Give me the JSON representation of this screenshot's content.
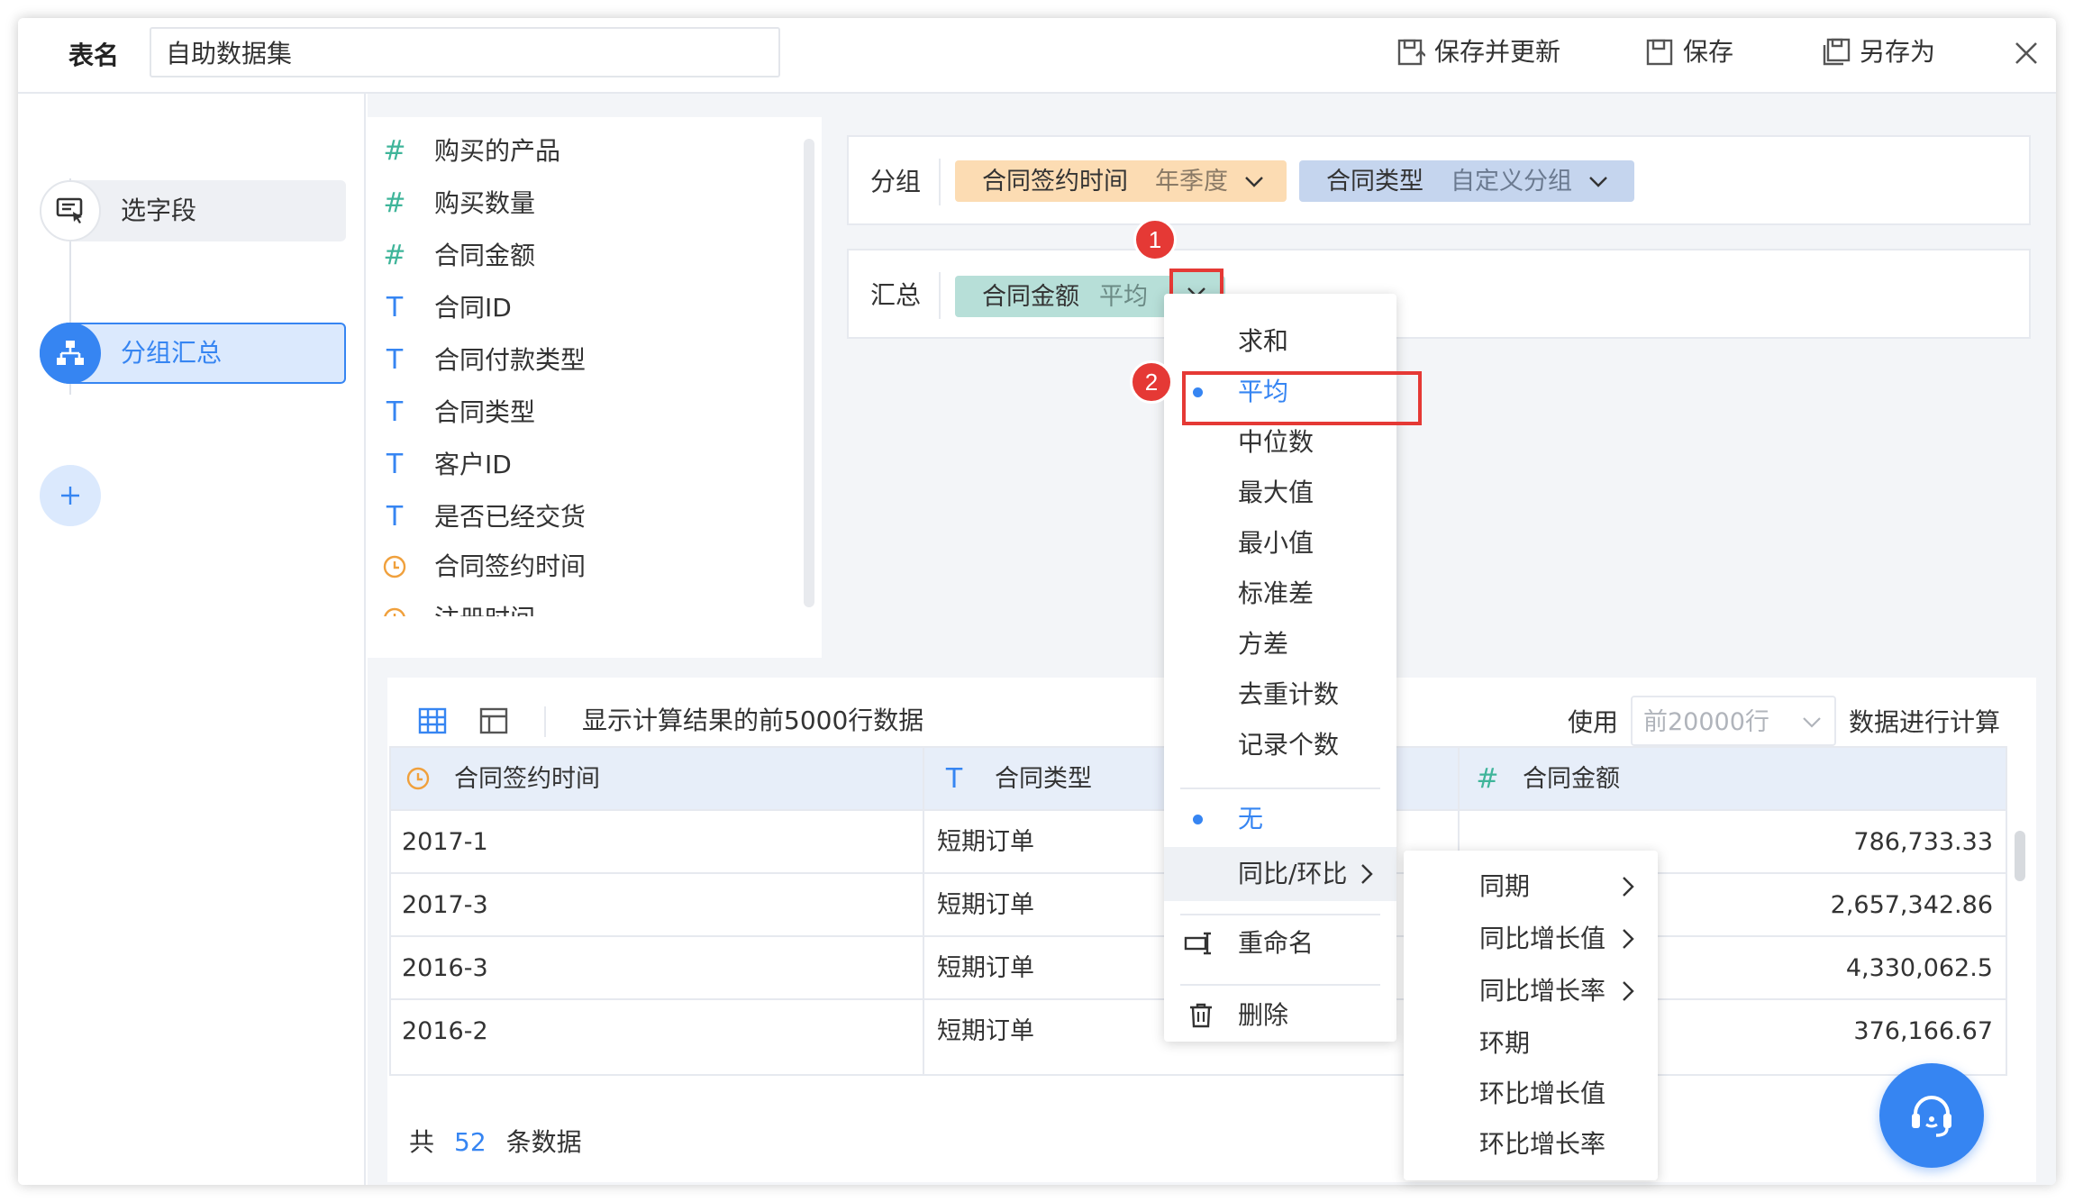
{
  "header": {
    "table_name_label": "表名",
    "table_name_value": "自助数据集",
    "save_update_label": "保存并更新",
    "save_label": "保存",
    "save_as_label": "另存为"
  },
  "steps": [
    {
      "label": "选字段"
    },
    {
      "label": "分组汇总"
    }
  ],
  "fields": [
    {
      "type": "#",
      "label": "购买的产品"
    },
    {
      "type": "#",
      "label": "购买数量"
    },
    {
      "type": "#",
      "label": "合同金额"
    },
    {
      "type": "T",
      "label": "合同ID"
    },
    {
      "type": "T",
      "label": "合同付款类型"
    },
    {
      "type": "T",
      "label": "合同类型"
    },
    {
      "type": "T",
      "label": "客户ID"
    },
    {
      "type": "T",
      "label": "是否已经交货"
    },
    {
      "type": "clock",
      "label": "合同签约时间"
    },
    {
      "type": "clock",
      "label": "注册时间"
    }
  ],
  "group": {
    "label": "分组",
    "chips": [
      {
        "name": "合同签约时间",
        "mode": "年季度"
      },
      {
        "name": "合同类型",
        "mode": "自定义分组"
      }
    ]
  },
  "summary": {
    "label": "汇总",
    "chip": {
      "name": "合同金额",
      "mode": "平均"
    }
  },
  "agg_menu": {
    "items": [
      "求和",
      "平均",
      "中位数",
      "最大值",
      "最小值",
      "标准差",
      "方差",
      "去重计数",
      "记录个数"
    ],
    "selected": "平均",
    "none_label": "无",
    "compare_label": "同比/环比",
    "rename_label": "重命名",
    "delete_label": "删除"
  },
  "compare_submenu": [
    "同期",
    "同比增长值",
    "同比增长率",
    "环期",
    "环比增长值",
    "环比增长率"
  ],
  "badges": [
    "1",
    "2"
  ],
  "preview": {
    "info_text": "显示计算结果的前5000行数据",
    "use_label": "使用",
    "rows_select_placeholder": "前20000行",
    "compute_label": "数据进行计算",
    "columns": [
      "合同签约时间",
      "合同类型",
      "合同金额"
    ],
    "rows": [
      [
        "2017-1",
        "短期订单",
        "786,733.33"
      ],
      [
        "2017-3",
        "短期订单",
        "2,657,342.86"
      ],
      [
        "2016-3",
        "短期订单",
        "4,330,062.5"
      ],
      [
        "2016-2",
        "短期订单",
        "376,166.67"
      ]
    ],
    "total_prefix": "共",
    "total_count": "52",
    "total_suffix": "条数据"
  },
  "colors": {
    "accent": "#3685f2",
    "group_chip_time": "#fcdcb3",
    "group_chip_type": "#c5d5ee",
    "summary_chip": "#b7dfd8",
    "highlight_red": "#e53935",
    "float_button": "#3685f2"
  }
}
